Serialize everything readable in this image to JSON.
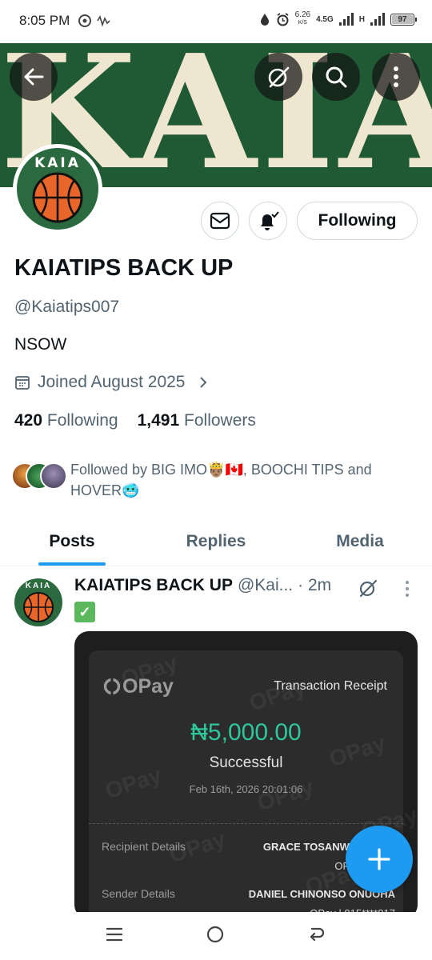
{
  "status_bar": {
    "time": "8:05 PM",
    "net_speed_value": "6.26",
    "net_speed_unit": "K/S",
    "network_type": "4.5G",
    "network_type_2": "H",
    "battery": "97"
  },
  "banner": {
    "text": "KAIA",
    "background_color": "#1f5a34",
    "text_color": "#efe6cf"
  },
  "profile": {
    "avatar_text": "KAIA",
    "follow_button_label": "Following",
    "display_name": "KAIATIPS BACK UP",
    "handle": "@Kaiatips007",
    "bio": "NSOW",
    "joined": "Joined August 2025",
    "following_count": "420",
    "following_label": "Following",
    "followers_count": "1,491",
    "followers_label": "Followers",
    "followed_by_line1": "Followed by BIG IMO🤴🏽🇨🇦, BOOCHI TIPS and",
    "followed_by_line2": "HOVER🥶"
  },
  "tabs": [
    {
      "label": "Posts",
      "active": true
    },
    {
      "label": "Replies",
      "active": false
    },
    {
      "label": "Media",
      "active": false
    }
  ],
  "post": {
    "author_name": "KAIATIPS BACK UP",
    "author_handle": "@Kai...",
    "time": "· 2m",
    "text_emoji": "✓",
    "receipt": {
      "brand": "OPay",
      "title": "Transaction Receipt",
      "amount": "₦5,000.00",
      "status": "Successful",
      "date": "Feb 16th, 2026 20:01:06",
      "recipient_label": "Recipient Details",
      "recipient_name": "GRACE TOSANWUMI ODO",
      "recipient_sub": "OPay | 802 8",
      "sender_label": "Sender Details",
      "sender_name": "DANIEL CHINONSO ONUOHA",
      "sender_sub": "OPay | 815****817",
      "amount_color": "#2ec79a"
    }
  },
  "accent_color": "#1d9bf0"
}
